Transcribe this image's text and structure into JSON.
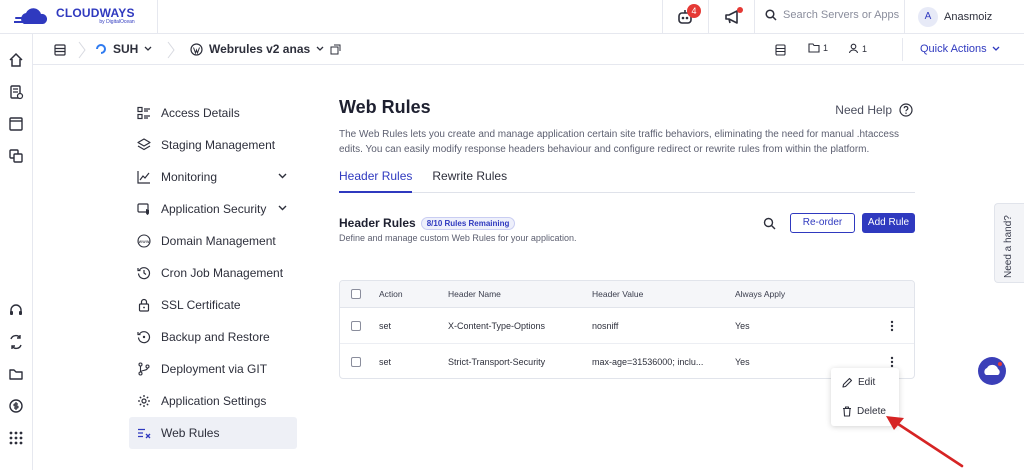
{
  "brand": {
    "name": "CLOUDWAYS",
    "sub": "by DigitalOcean"
  },
  "topbar": {
    "notifications_count": "4",
    "search_placeholder": "Search Servers or Apps",
    "user_initial": "A",
    "user_name": "Anasmoiz"
  },
  "breadcrumb": {
    "server": "SUH",
    "app": "Webrules v2 anas",
    "folders_count": "1",
    "users_count": "1",
    "quick_actions": "Quick Actions"
  },
  "sidenav": {
    "items": [
      {
        "label": "Access Details",
        "icon": "access-details-icon"
      },
      {
        "label": "Staging Management",
        "icon": "layers-icon"
      },
      {
        "label": "Monitoring",
        "icon": "chart-icon",
        "expandable": true
      },
      {
        "label": "Application Security",
        "icon": "security-icon",
        "expandable": true
      },
      {
        "label": "Domain Management",
        "icon": "www-icon"
      },
      {
        "label": "Cron Job Management",
        "icon": "history-icon"
      },
      {
        "label": "SSL Certificate",
        "icon": "lock-icon"
      },
      {
        "label": "Backup and Restore",
        "icon": "backup-icon"
      },
      {
        "label": "Deployment via GIT",
        "icon": "git-icon"
      },
      {
        "label": "Application Settings",
        "icon": "gear-icon"
      },
      {
        "label": "Web Rules",
        "icon": "web-rules-icon",
        "active": true
      }
    ]
  },
  "main": {
    "title": "Web Rules",
    "need_help": "Need Help",
    "description": "The Web Rules lets you create and manage application certain site traffic behaviors, eliminating the need for manual .htaccess edits. You can easily modify response headers behaviour and configure redirect or rewrite rules from within the platform.",
    "tabs": [
      {
        "label": "Header Rules",
        "active": true
      },
      {
        "label": "Rewrite Rules",
        "active": false
      }
    ],
    "section": {
      "title": "Header Rules",
      "remaining": "8/10 Rules Remaining",
      "subtitle": "Define and manage custom Web Rules for your application.",
      "reorder_label": "Re-order",
      "add_label": "Add Rule"
    },
    "table": {
      "headers": [
        "Action",
        "Header Name",
        "Header Value",
        "Always Apply"
      ],
      "rows": [
        {
          "action": "set",
          "name": "X-Content-Type-Options",
          "value": "nosniff",
          "always": "Yes"
        },
        {
          "action": "set",
          "name": "Strict-Transport-Security",
          "value": "max-age=31536000; inclu...",
          "always": "Yes"
        }
      ]
    },
    "row_menu": {
      "edit": "Edit",
      "delete": "Delete"
    }
  },
  "help_tab": "Need a hand?",
  "colors": {
    "accent": "#2f39bf",
    "danger": "#e53935",
    "arrow": "#d62424"
  }
}
